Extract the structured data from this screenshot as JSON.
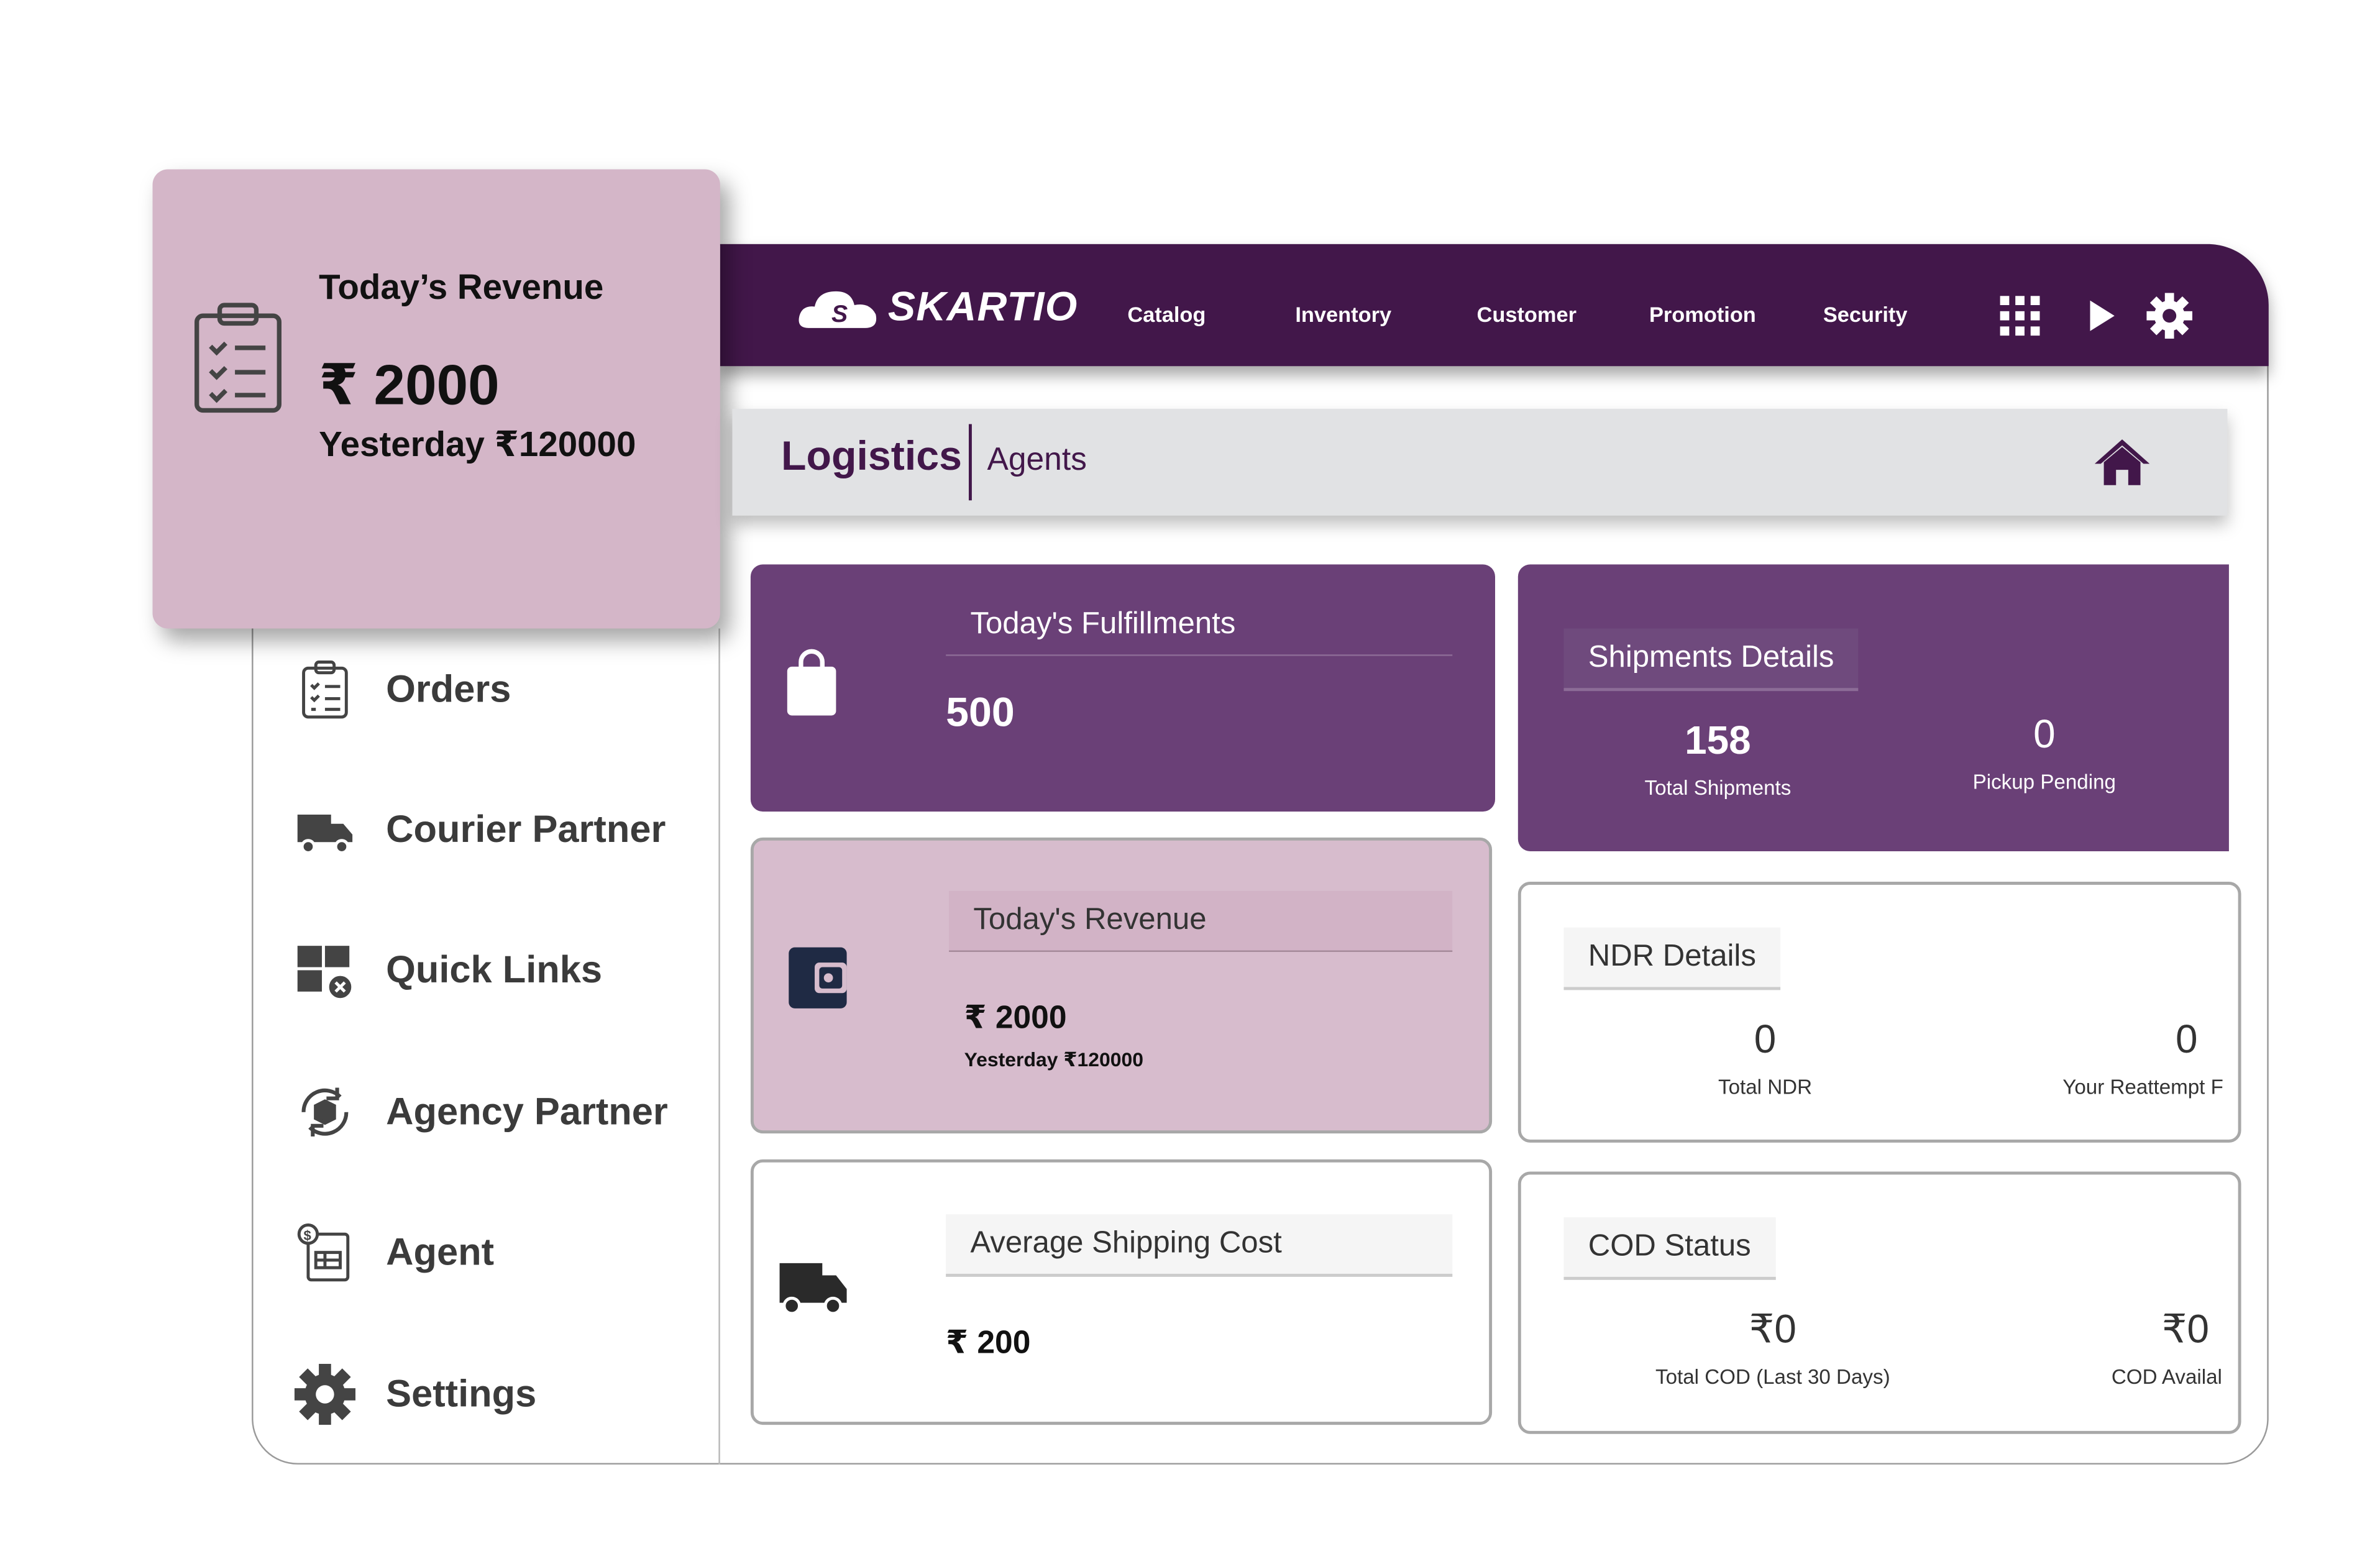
{
  "brand": {
    "name": "SKARTIO",
    "color": "#42174a"
  },
  "nav": [
    "Catalog",
    "Inventory",
    "Customer",
    "Promotion",
    "Security"
  ],
  "header_icons": [
    "grid-icon",
    "play-icon",
    "gear-icon"
  ],
  "overlay": {
    "title": "Today’s Revenue",
    "value": "₹ 2000",
    "yesterday": "Yesterday ₹120000"
  },
  "breadcrumb": {
    "section": "Logistics",
    "page": "Agents"
  },
  "sidebar": [
    "Orders",
    "Courier Partner",
    "Quick Links",
    "Agency Partner",
    "Agent",
    "Settings"
  ],
  "cards": {
    "fulfillments": {
      "title": "Today's Fulfillments",
      "value": "500"
    },
    "revenue": {
      "title": "Today's Revenue",
      "value": "₹ 2000",
      "yesterday": "Yesterday ₹120000"
    },
    "shipping": {
      "title": "Average Shipping Cost",
      "value": "₹ 200"
    },
    "shipments": {
      "title": "Shipments Details",
      "stats": [
        {
          "value": "158",
          "label": "Total Shipments"
        },
        {
          "value": "0",
          "label": "Pickup Pending"
        }
      ]
    },
    "ndr": {
      "title": "NDR Details",
      "stats": [
        {
          "value": "0",
          "label": "Total NDR"
        },
        {
          "value": "0",
          "label": "Your Reattempt F"
        }
      ]
    },
    "cod": {
      "title": "COD Status",
      "stats": [
        {
          "value": "₹0",
          "label": "Total COD (Last 30 Days)"
        },
        {
          "value": "₹0",
          "label": "COD Availal"
        }
      ]
    }
  },
  "colors": {
    "header": "#42174a",
    "card_purple": "#6a4077",
    "card_pink": "#d7bccd",
    "overlay": "#d4b6c8",
    "breadcrumb": "#e1e2e4"
  }
}
